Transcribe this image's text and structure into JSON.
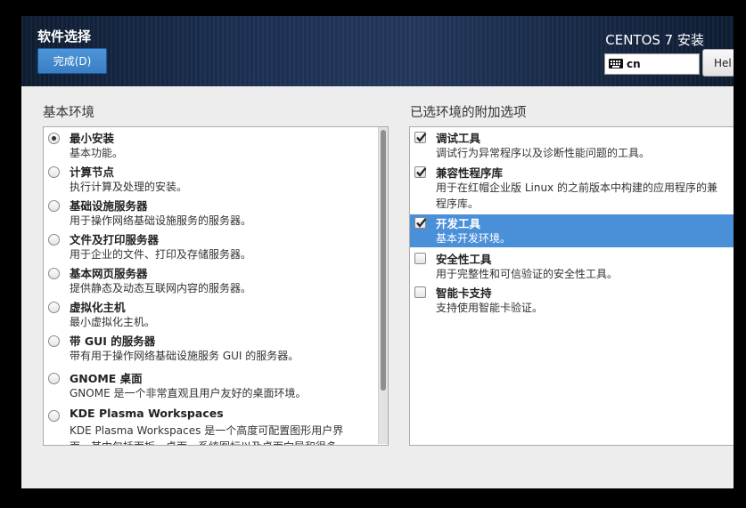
{
  "header": {
    "title": "软件选择",
    "done_label": "完成(D)",
    "product": "CENTOS 7 安装",
    "keyboard_layout": "cn",
    "help_label": "Hel"
  },
  "environments": {
    "label": "基本环境",
    "items": [
      {
        "title": "最小安装",
        "desc": [
          "基本功能。"
        ],
        "selected": true
      },
      {
        "title": "计算节点",
        "desc": [
          "执行计算及处理的安装。"
        ],
        "selected": false
      },
      {
        "title": "基础设施服务器",
        "desc": [
          "用于操作网络基础设施服务的服务器。"
        ],
        "selected": false
      },
      {
        "title": "文件及打印服务器",
        "desc": [
          "用于企业的文件、打印及存储服务器。"
        ],
        "selected": false
      },
      {
        "title": "基本网页服务器",
        "desc": [
          "提供静态及动态互联网内容的服务器。"
        ],
        "selected": false
      },
      {
        "title": "虚拟化主机",
        "desc": [
          "最小虚拟化主机。"
        ],
        "selected": false
      },
      {
        "title": "带 GUI 的服务器",
        "desc": [
          "带有用于操作网络基础设施服务 GUI 的服务器。"
        ],
        "selected": false
      },
      {
        "title": "GNOME 桌面",
        "desc": [
          "GNOME 是一个非常直观且用户友好的桌面环境。"
        ],
        "selected": false
      },
      {
        "title": "KDE Plasma Workspaces",
        "desc": [
          "KDE Plasma Workspaces 是一个高度可配置图形用户界",
          "面，其中包括面板、桌面、系统图标以及桌面向导和很多"
        ],
        "selected": false
      }
    ]
  },
  "addons": {
    "label": "已选环境的附加选项",
    "items": [
      {
        "title": "调试工具",
        "desc": [
          "调试行为异常程序以及诊断性能问题的工具。"
        ],
        "checked": true,
        "highlighted": false
      },
      {
        "title": "兼容性程序库",
        "desc": [
          "用于在红帽企业版 Linux 的之前版本中构建的应用程序的兼",
          "程序库。"
        ],
        "checked": true,
        "highlighted": false
      },
      {
        "title": "开发工具",
        "desc": [
          "基本开发环境。"
        ],
        "checked": true,
        "highlighted": true
      },
      {
        "title": "安全性工具",
        "desc": [
          "用于完整性和可信验证的安全性工具。"
        ],
        "checked": false,
        "highlighted": false
      },
      {
        "title": "智能卡支持",
        "desc": [
          "支持使用智能卡验证。"
        ],
        "checked": false,
        "highlighted": false
      }
    ]
  }
}
